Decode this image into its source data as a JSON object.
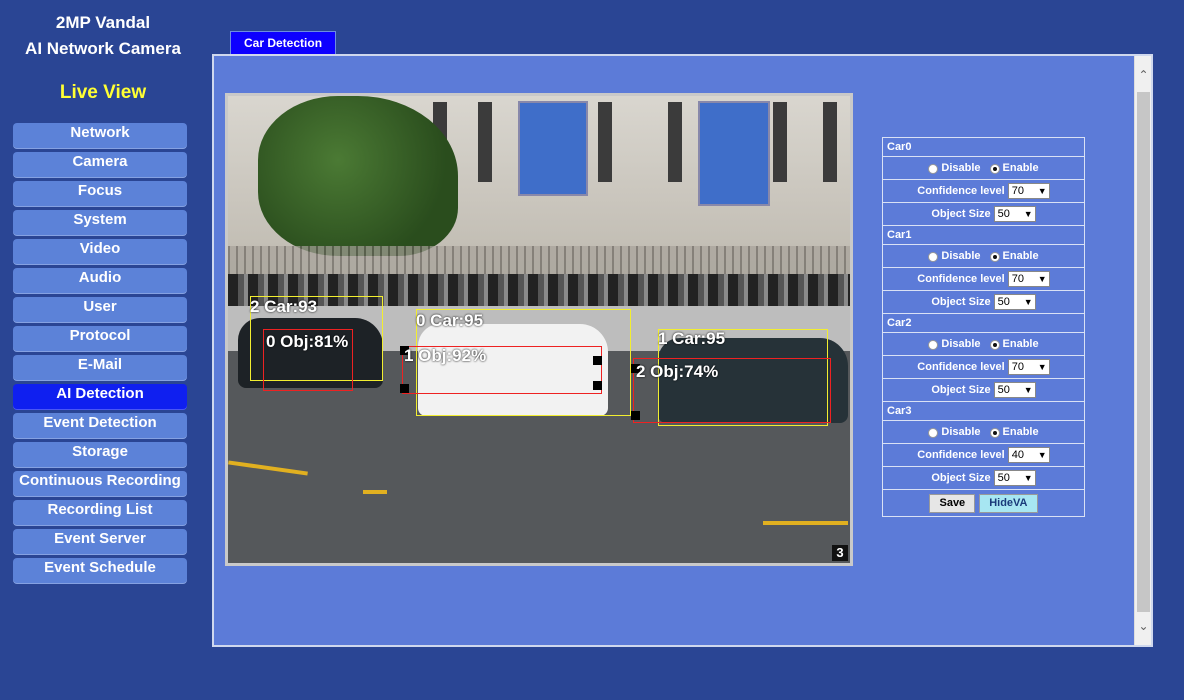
{
  "brand": {
    "line1": "2MP Vandal",
    "line2": "AI Network Camera"
  },
  "live_view": "Live View",
  "nav": [
    "Network",
    "Camera",
    "Focus",
    "System",
    "Video",
    "Audio",
    "User",
    "Protocol",
    "E-Mail",
    "AI Detection",
    "Event Detection",
    "Storage",
    "Continuous Recording",
    "Recording List",
    "Event Server",
    "Event Schedule"
  ],
  "active_nav": "AI Detection",
  "tab": "Car Detection",
  "video": {
    "detections": [
      {
        "label": "2 Car:93",
        "kind": "car"
      },
      {
        "label": "0 Obj:81%",
        "kind": "obj"
      },
      {
        "label": "0 Car:95",
        "kind": "car"
      },
      {
        "label": "1 Obj:92%",
        "kind": "obj"
      },
      {
        "label": "1 Car:95",
        "kind": "car"
      },
      {
        "label": "2 Obj:74%",
        "kind": "obj"
      }
    ],
    "camera_number": "3"
  },
  "settings": {
    "disable_label": "Disable",
    "enable_label": "Enable",
    "confidence_label": "Confidence level",
    "object_size_label": "Object Size",
    "cars": [
      {
        "name": "Car0",
        "mode": "Enable",
        "confidence": "70",
        "object_size": "50"
      },
      {
        "name": "Car1",
        "mode": "Enable",
        "confidence": "70",
        "object_size": "50"
      },
      {
        "name": "Car2",
        "mode": "Enable",
        "confidence": "70",
        "object_size": "50"
      },
      {
        "name": "Car3",
        "mode": "Enable",
        "confidence": "40",
        "object_size": "50"
      }
    ],
    "save_label": "Save",
    "hide_label": "HideVA"
  }
}
